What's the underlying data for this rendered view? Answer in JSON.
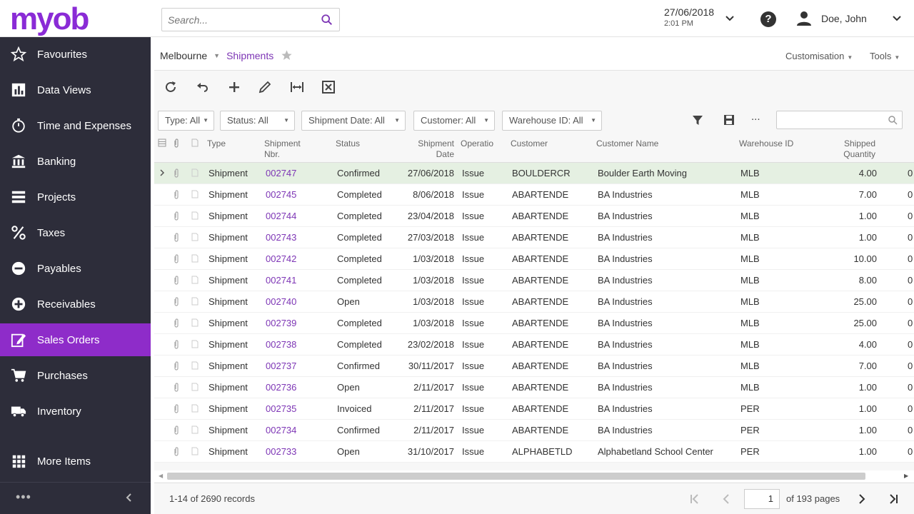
{
  "app": {
    "logo": "myob"
  },
  "header": {
    "search_placeholder": "Search...",
    "date": "27/06/2018",
    "time": "2:01 PM",
    "user": "Doe, John"
  },
  "sidebar": {
    "items": [
      {
        "label": "Favourites",
        "icon": "star-icon"
      },
      {
        "label": "Data Views",
        "icon": "bar-chart-icon"
      },
      {
        "label": "Time and Expenses",
        "icon": "stopwatch-icon"
      },
      {
        "label": "Banking",
        "icon": "bank-icon"
      },
      {
        "label": "Projects",
        "icon": "projects-icon"
      },
      {
        "label": "Taxes",
        "icon": "percent-icon"
      },
      {
        "label": "Payables",
        "icon": "minus-circle-icon"
      },
      {
        "label": "Receivables",
        "icon": "plus-circle-icon"
      },
      {
        "label": "Sales Orders",
        "icon": "edit-icon"
      },
      {
        "label": "Purchases",
        "icon": "cart-icon"
      },
      {
        "label": "Inventory",
        "icon": "truck-icon"
      },
      {
        "label": "More Items",
        "icon": "grid-icon"
      }
    ],
    "active_item": "Sales Orders",
    "more_dots": "•••"
  },
  "breadcrumb": {
    "branch": "Melbourne",
    "page": "Shipments"
  },
  "top_menu": {
    "customisation": "Customisation",
    "tools": "Tools"
  },
  "filters": {
    "type": "Type: All",
    "status": "Status: All",
    "shipment_date": "Shipment Date: All",
    "customer": "Customer: All",
    "warehouse": "Warehouse ID: All",
    "more": "..."
  },
  "grid": {
    "columns": {
      "type": "Type",
      "shipment_nbr": "Shipment Nbr.",
      "status": "Status",
      "shipment_date": "Shipment Date",
      "operation": "Operatio",
      "customer": "Customer",
      "customer_name": "Customer Name",
      "warehouse_id": "Warehouse ID",
      "shipped_quantity": "Shipped Quantity"
    },
    "rows": [
      {
        "type": "Shipment",
        "nbr": "002747",
        "status": "Confirmed",
        "date": "27/06/2018",
        "op": "Issue",
        "customer": "BOULDERCR",
        "name": "Boulder Earth Moving",
        "wh": "MLB",
        "qty": "4.00"
      },
      {
        "type": "Shipment",
        "nbr": "002745",
        "status": "Completed",
        "date": "8/06/2018",
        "op": "Issue",
        "customer": "ABARTENDE",
        "name": "BA Industries",
        "wh": "MLB",
        "qty": "7.00"
      },
      {
        "type": "Shipment",
        "nbr": "002744",
        "status": "Completed",
        "date": "23/04/2018",
        "op": "Issue",
        "customer": "ABARTENDE",
        "name": "BA Industries",
        "wh": "MLB",
        "qty": "1.00"
      },
      {
        "type": "Shipment",
        "nbr": "002743",
        "status": "Completed",
        "date": "27/03/2018",
        "op": "Issue",
        "customer": "ABARTENDE",
        "name": "BA Industries",
        "wh": "MLB",
        "qty": "1.00"
      },
      {
        "type": "Shipment",
        "nbr": "002742",
        "status": "Completed",
        "date": "1/03/2018",
        "op": "Issue",
        "customer": "ABARTENDE",
        "name": "BA Industries",
        "wh": "MLB",
        "qty": "10.00"
      },
      {
        "type": "Shipment",
        "nbr": "002741",
        "status": "Completed",
        "date": "1/03/2018",
        "op": "Issue",
        "customer": "ABARTENDE",
        "name": "BA Industries",
        "wh": "MLB",
        "qty": "8.00"
      },
      {
        "type": "Shipment",
        "nbr": "002740",
        "status": "Open",
        "date": "1/03/2018",
        "op": "Issue",
        "customer": "ABARTENDE",
        "name": "BA Industries",
        "wh": "MLB",
        "qty": "25.00"
      },
      {
        "type": "Shipment",
        "nbr": "002739",
        "status": "Completed",
        "date": "1/03/2018",
        "op": "Issue",
        "customer": "ABARTENDE",
        "name": "BA Industries",
        "wh": "MLB",
        "qty": "25.00"
      },
      {
        "type": "Shipment",
        "nbr": "002738",
        "status": "Completed",
        "date": "23/02/2018",
        "op": "Issue",
        "customer": "ABARTENDE",
        "name": "BA Industries",
        "wh": "MLB",
        "qty": "4.00"
      },
      {
        "type": "Shipment",
        "nbr": "002737",
        "status": "Confirmed",
        "date": "30/11/2017",
        "op": "Issue",
        "customer": "ABARTENDE",
        "name": "BA Industries",
        "wh": "MLB",
        "qty": "7.00"
      },
      {
        "type": "Shipment",
        "nbr": "002736",
        "status": "Open",
        "date": "2/11/2017",
        "op": "Issue",
        "customer": "ABARTENDE",
        "name": "BA Industries",
        "wh": "MLB",
        "qty": "1.00"
      },
      {
        "type": "Shipment",
        "nbr": "002735",
        "status": "Invoiced",
        "date": "2/11/2017",
        "op": "Issue",
        "customer": "ABARTENDE",
        "name": "BA Industries",
        "wh": "PER",
        "qty": "1.00"
      },
      {
        "type": "Shipment",
        "nbr": "002734",
        "status": "Confirmed",
        "date": "2/11/2017",
        "op": "Issue",
        "customer": "ABARTENDE",
        "name": "BA Industries",
        "wh": "PER",
        "qty": "1.00"
      },
      {
        "type": "Shipment",
        "nbr": "002733",
        "status": "Open",
        "date": "31/10/2017",
        "op": "Issue",
        "customer": "ALPHABETLD",
        "name": "Alphabetland School Center",
        "wh": "PER",
        "qty": "1.00"
      }
    ],
    "overflow_col_text": "0"
  },
  "footer": {
    "records": "1-14 of 2690 records",
    "page_value": "1",
    "of_pages": "of 193 pages"
  },
  "colors": {
    "brand": "#8a2bd6",
    "sidebar": "#2d2d3a",
    "active": "#8e2cc9",
    "link": "#7d35b5",
    "selected_row": "#e5f0e2"
  }
}
